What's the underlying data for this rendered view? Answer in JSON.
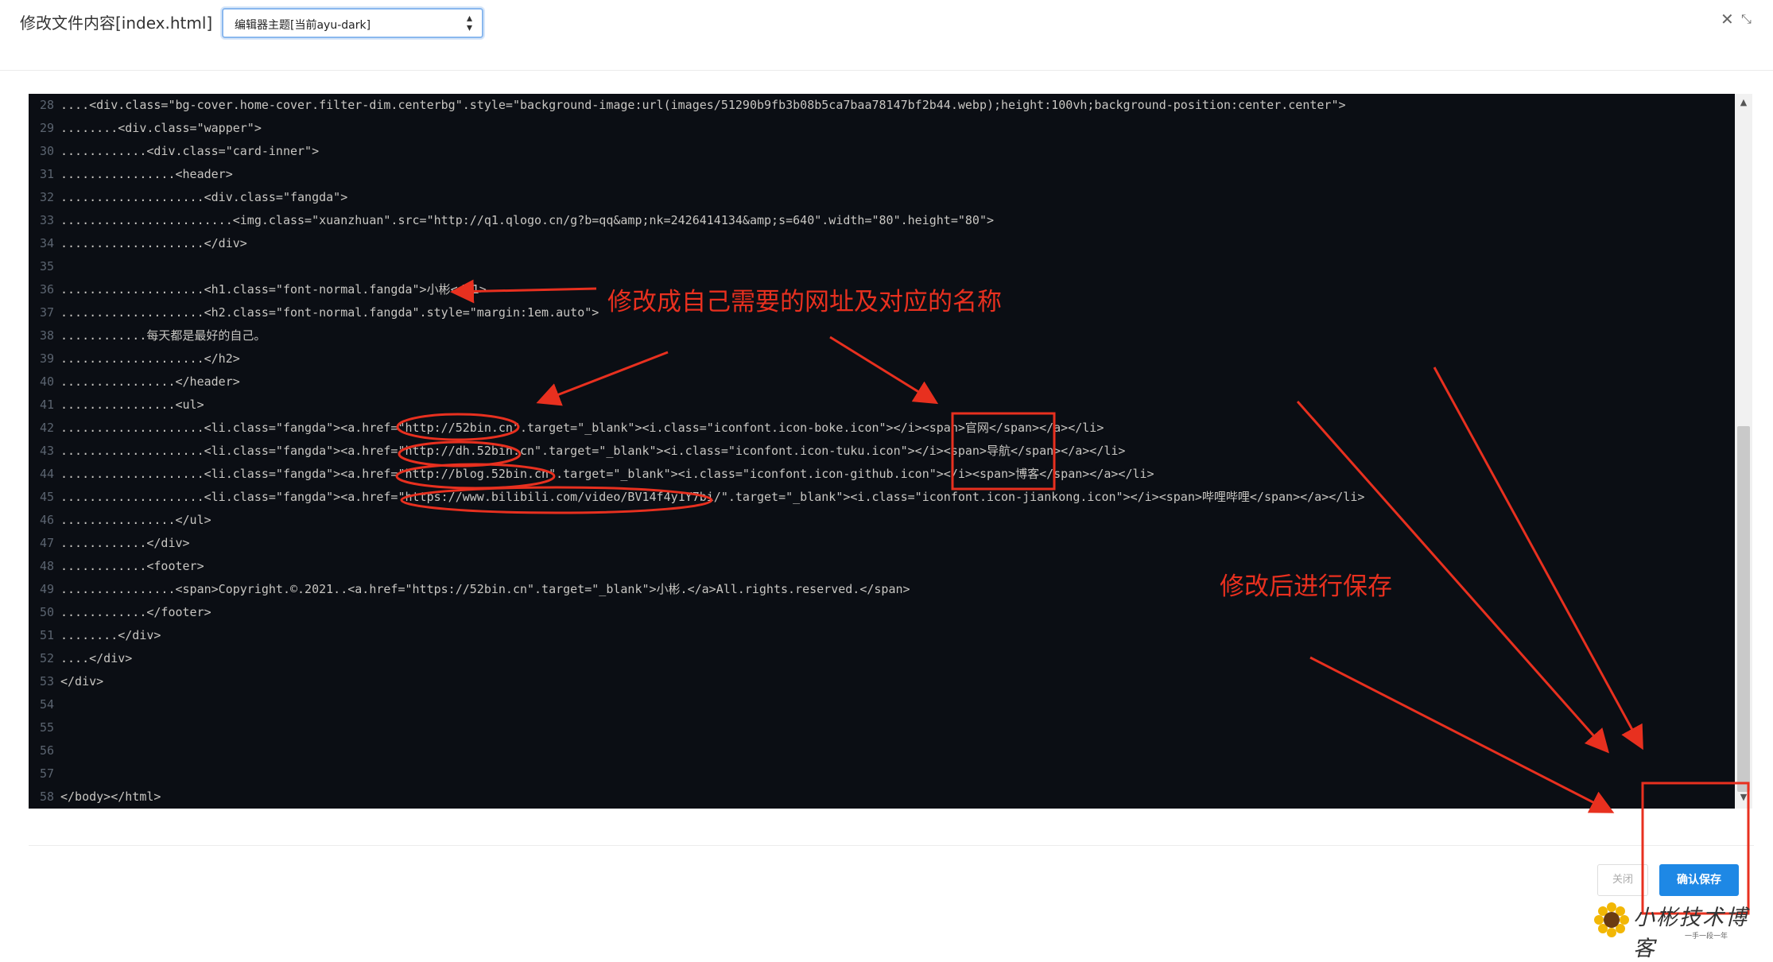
{
  "header": {
    "title": "修改文件内容[index.html]",
    "theme_select_value": "编辑器主题[当前ayu-dark]",
    "close_glyph": "✕",
    "fullscreen_glyph": "⤡"
  },
  "editor": {
    "lines": [
      {
        "n": "28",
        "t": "....<div.class=\"bg-cover.home-cover.filter-dim.centerbg\".style=\"background-image:url(images/51290b9fb3b08b5ca7baa78147bf2b44.webp);height:100vh;background-position:center.center\">"
      },
      {
        "n": "29",
        "t": "........<div.class=\"wapper\">"
      },
      {
        "n": "30",
        "t": "............<div.class=\"card-inner\">"
      },
      {
        "n": "31",
        "t": "................<header>"
      },
      {
        "n": "32",
        "t": "....................<div.class=\"fangda\">"
      },
      {
        "n": "33",
        "t": "........................<img.class=\"xuanzhuan\".src=\"http://q1.qlogo.cn/g?b=qq&amp;nk=2426414134&amp;s=640\".width=\"80\".height=\"80\">"
      },
      {
        "n": "34",
        "t": "....................</div>"
      },
      {
        "n": "35",
        "t": ""
      },
      {
        "n": "36",
        "t": "....................<h1.class=\"font-normal.fangda\">小彬</h1>"
      },
      {
        "n": "37",
        "t": "....................<h2.class=\"font-normal.fangda\".style=\"margin:1em.auto\">"
      },
      {
        "n": "38",
        "t": "............每天都是最好的自己。"
      },
      {
        "n": "39",
        "t": "....................</h2>"
      },
      {
        "n": "40",
        "t": "................</header>"
      },
      {
        "n": "41",
        "t": "................<ul>"
      },
      {
        "n": "42",
        "t": "....................<li.class=\"fangda\"><a.href=\"http://52bin.cn\".target=\"_blank\"><i.class=\"iconfont.icon-boke.icon\"></i><span>官网</span></a></li>"
      },
      {
        "n": "43",
        "t": "....................<li.class=\"fangda\"><a.href=\"http://dh.52bin.cn\".target=\"_blank\"><i.class=\"iconfont.icon-tuku.icon\"></i><span>导航</span></a></li>"
      },
      {
        "n": "44",
        "t": "....................<li.class=\"fangda\"><a.href=\"http://blog.52bin.cn\".target=\"_blank\"><i.class=\"iconfont.icon-github.icon\"></i><span>博客</span></a></li>"
      },
      {
        "n": "45",
        "t": "....................<li.class=\"fangda\"><a.href=\"https://www.bilibili.com/video/BV14f4y1Y7bi/\".target=\"_blank\"><i.class=\"iconfont.icon-jiankong.icon\"></i><span>哔哩哔哩</span></a></li>"
      },
      {
        "n": "46",
        "t": "................</ul>"
      },
      {
        "n": "47",
        "t": "............</div>"
      },
      {
        "n": "48",
        "t": "............<footer>"
      },
      {
        "n": "49",
        "t": "................<span>Copyright.©.2021..<a.href=\"https://52bin.cn\".target=\"_blank\">小彬.</a>All.rights.reserved.</span>"
      },
      {
        "n": "50",
        "t": "............</footer>"
      },
      {
        "n": "51",
        "t": "........</div>"
      },
      {
        "n": "52",
        "t": "....</div>"
      },
      {
        "n": "53",
        "t": "</div>"
      },
      {
        "n": "54",
        "t": ""
      },
      {
        "n": "55",
        "t": ""
      },
      {
        "n": "56",
        "t": ""
      },
      {
        "n": "57",
        "t": ""
      },
      {
        "n": "58",
        "t": "</body></html>"
      }
    ]
  },
  "footer": {
    "close_label": "关闭",
    "save_label": "确认保存"
  },
  "annotations": {
    "note_modify": "修改成自己需要的网址及对应的名称",
    "note_save": "修改后进行保存",
    "color": "#e8301f"
  },
  "watermark": {
    "title": "小彬技术博客",
    "subtitle": "一手一段一年"
  }
}
